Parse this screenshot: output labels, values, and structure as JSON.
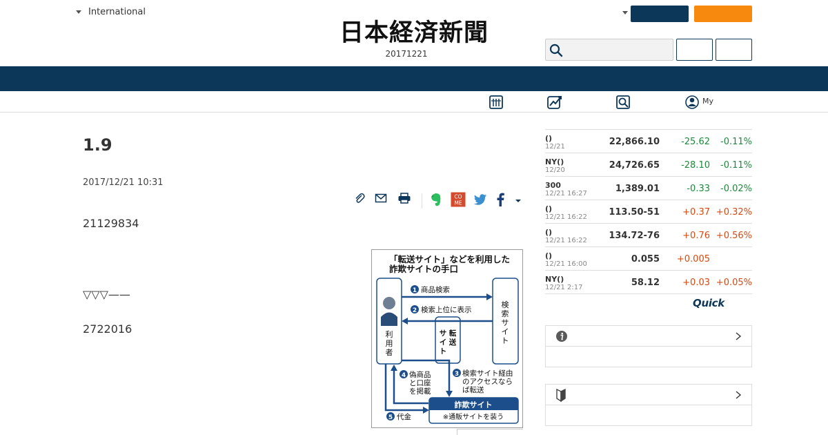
{
  "header": {
    "edition": "International",
    "logo": "日本経済新聞",
    "date": "20171221",
    "subnav_my": "My"
  },
  "article": {
    "title": "1.9",
    "published": "2017/12/21 10:31",
    "para1": "21129834",
    "para2": "▽▽▽——",
    "para3": "2722016"
  },
  "figure": {
    "title_line1": "「転送サイト」などを利用した",
    "title_line2": "詐欺サイトの手口",
    "user": [
      "利",
      "用",
      "者"
    ],
    "search_site": [
      "検",
      "索",
      "サ",
      "イ",
      "ト"
    ],
    "transfer_col1": [
      "サ",
      "イ",
      "ト"
    ],
    "transfer_col2": [
      "転",
      "送"
    ],
    "step1": "商品検索",
    "step2": "検索上位に表示",
    "step3_line1": "検索サイト経由",
    "step3_line2": "のアクセスなら",
    "step3_line3": "ば転送",
    "step4_line1": "偽商品",
    "step4_line2": "と口座",
    "step4_line3": "を掲載",
    "step5": "代金",
    "fraud_site": "詐欺サイト",
    "fraud_note": "※通販サイトを装う",
    "num1": "1",
    "num2": "2",
    "num3": "3",
    "num4": "4",
    "num5": "5"
  },
  "market": {
    "rows": [
      {
        "name": "()",
        "time": "12/21",
        "value": "22,866.10",
        "change": "-25.62",
        "pct": "-0.11%",
        "dir": "down"
      },
      {
        "name": "NY()",
        "time": "12/20",
        "value": "24,726.65",
        "change": "-28.10",
        "pct": "-0.11%",
        "dir": "down"
      },
      {
        "name": "300",
        "time": "12/21 16:27",
        "value": "1,389.01",
        "change": "-0.33",
        "pct": "-0.02%",
        "dir": "down"
      },
      {
        "name": "()",
        "time": "12/21 16:22",
        "value": "113.50-51",
        "change": "+0.37",
        "pct": "+0.32%",
        "dir": "up"
      },
      {
        "name": "()",
        "time": "12/21 16:22",
        "value": "134.72-76",
        "change": "+0.76",
        "pct": "+0.56%",
        "dir": "up"
      },
      {
        "name": "()",
        "time": "12/21 16:00",
        "value": "0.055",
        "change": "+0.005",
        "pct": "",
        "dir": "up"
      },
      {
        "name": "NY()",
        "time": "12/21 2:17",
        "value": "58.12",
        "change": "+0.03",
        "pct": "+0.05%",
        "dir": "up"
      }
    ],
    "logo": "Quick"
  },
  "colors": {
    "navy": "#0c3759",
    "orange": "#f7890f",
    "down": "#1a8a3a",
    "up": "#d9480f"
  }
}
